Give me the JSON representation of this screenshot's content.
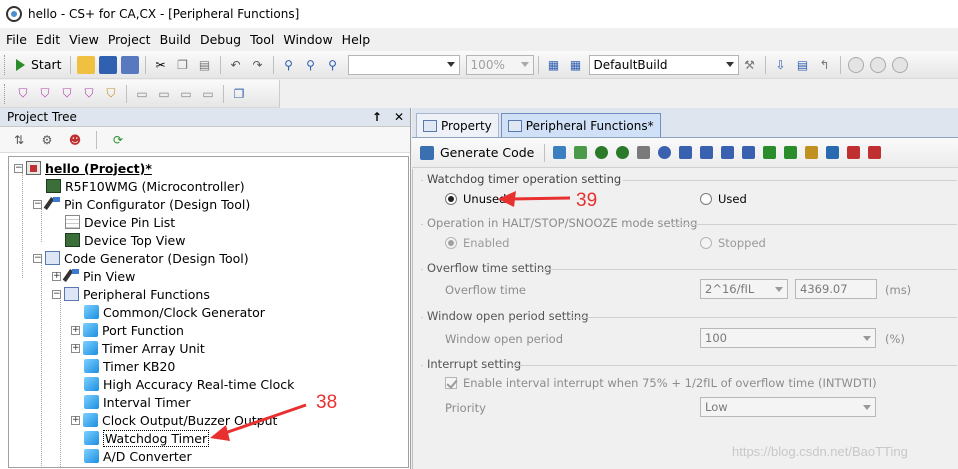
{
  "window": {
    "title": "hello - CS+ for CA,CX - [Peripheral Functions]"
  },
  "menu": [
    "File",
    "Edit",
    "View",
    "Project",
    "Build",
    "Debug",
    "Tool",
    "Window",
    "Help"
  ],
  "toolbar": {
    "start_label": "Start",
    "zoom_value": "100%",
    "build_config": "DefaultBuild"
  },
  "project_tree": {
    "title": "Project Tree",
    "pin_btn": "↑",
    "close_btn": "✕",
    "items": [
      {
        "label": "hello (Project)*"
      },
      {
        "label": "R5F10WMG (Microcontroller)"
      },
      {
        "label": "Pin Configurator (Design Tool)"
      },
      {
        "label": "Device Pin List"
      },
      {
        "label": "Device Top View"
      },
      {
        "label": "Code Generator (Design Tool)"
      },
      {
        "label": "Pin View"
      },
      {
        "label": "Peripheral Functions"
      },
      {
        "label": "Common/Clock Generator"
      },
      {
        "label": "Port Function"
      },
      {
        "label": "Timer Array Unit"
      },
      {
        "label": "Timer KB20"
      },
      {
        "label": "High Accuracy Real-time Clock"
      },
      {
        "label": "Interval Timer"
      },
      {
        "label": "Clock Output/Buzzer Output"
      },
      {
        "label": "Watchdog Timer"
      },
      {
        "label": "A/D Converter"
      }
    ]
  },
  "tabs": [
    {
      "label": "Property"
    },
    {
      "label": "Peripheral Functions*"
    }
  ],
  "panel_toolbar": {
    "generate_label": "Generate Code"
  },
  "watchdog": {
    "operation_title": "Watchdog timer operation setting",
    "unused_label": "Unused",
    "used_label": "Used",
    "halt_title": "Operation in HALT/STOP/SNOOZE mode setting",
    "enabled_label": "Enabled",
    "stopped_label": "Stopped",
    "overflow_title": "Overflow time setting",
    "overflow_label": "Overflow time",
    "overflow_select": "2^16/fIL",
    "overflow_value": "4369.07",
    "overflow_unit": "(ms)",
    "window_title": "Window open period setting",
    "window_label": "Window open period",
    "window_select": "100",
    "window_unit": "(%)",
    "interrupt_title": "Interrupt setting",
    "interrupt_check_label": "Enable interval interrupt when 75% + 1/2fIL of overflow time (INTWDTI)",
    "priority_label": "Priority",
    "priority_select": "Low"
  },
  "annotations": {
    "step_39": "39",
    "step_38": "38"
  },
  "watermark": "https://blog.csdn.net/BaoTTing",
  "colors": {
    "annotation": "#e83030",
    "tab_active": "#cfe0f7"
  }
}
